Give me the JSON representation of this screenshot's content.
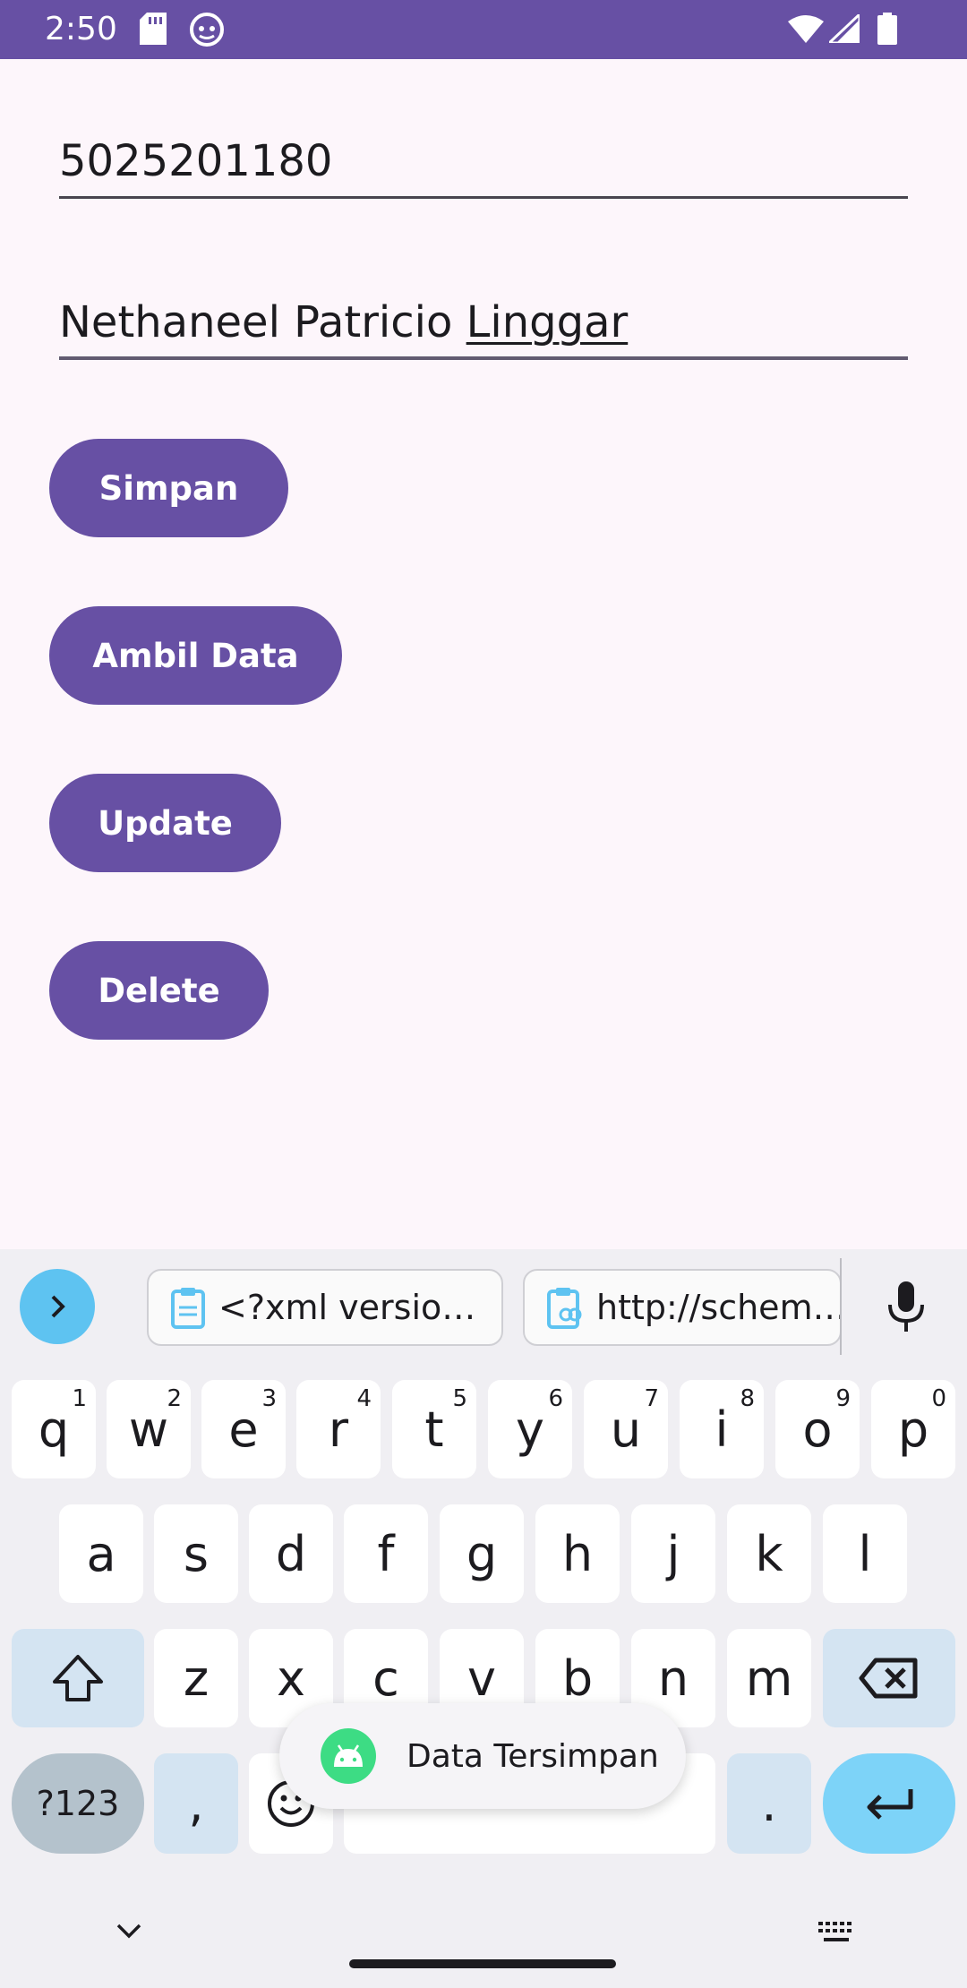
{
  "status_bar": {
    "time": "2:50",
    "icons": [
      "sd-card-icon",
      "android-debug-icon",
      "wifi-icon",
      "signal-icon",
      "battery-icon"
    ]
  },
  "form": {
    "nrp_value": "5025201180",
    "name_value_prefix": "Nethaneel Patricio ",
    "name_value_composing": "Linggar"
  },
  "buttons": {
    "simpan": "Simpan",
    "ambil_data": "Ambil Data",
    "update": "Update",
    "delete": "Delete"
  },
  "keyboard": {
    "clipboard_chips": [
      "<?xml versio…",
      "http://schem…"
    ],
    "row1": [
      {
        "k": "q",
        "s": "1"
      },
      {
        "k": "w",
        "s": "2"
      },
      {
        "k": "e",
        "s": "3"
      },
      {
        "k": "r",
        "s": "4"
      },
      {
        "k": "t",
        "s": "5"
      },
      {
        "k": "y",
        "s": "6"
      },
      {
        "k": "u",
        "s": "7"
      },
      {
        "k": "i",
        "s": "8"
      },
      {
        "k": "o",
        "s": "9"
      },
      {
        "k": "p",
        "s": "0"
      }
    ],
    "row2": [
      "a",
      "s",
      "d",
      "f",
      "g",
      "h",
      "j",
      "k",
      "l"
    ],
    "row3": [
      "z",
      "x",
      "c",
      "v",
      "b",
      "n",
      "m"
    ],
    "symbols_label": "?123",
    "comma": ",",
    "period": "."
  },
  "toast": {
    "message": "Data Tersimpan"
  },
  "colors": {
    "primary": "#6750a4",
    "background": "#fdf6fb",
    "accent": "#7dd3f8"
  }
}
